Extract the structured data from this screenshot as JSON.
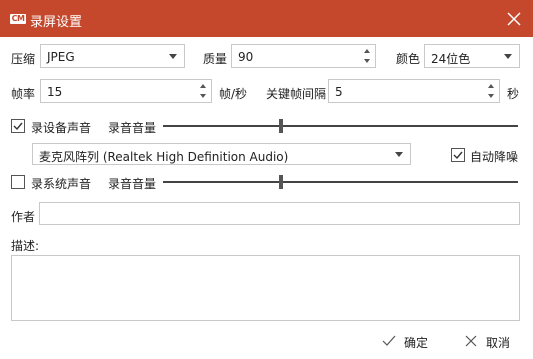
{
  "window": {
    "title": "录屏设置",
    "logo": "CM"
  },
  "compression": {
    "label": "压缩",
    "value": "JPEG"
  },
  "quality": {
    "label": "质量",
    "value": "90"
  },
  "color": {
    "label": "颜色",
    "value": "24位色"
  },
  "framerate": {
    "label": "帧率",
    "value": "15",
    "unit": "帧/秒"
  },
  "keyframe": {
    "label": "关键帧间隔",
    "value": "5",
    "unit": "秒"
  },
  "device_audio": {
    "checkbox_label": "录设备声音",
    "checked": true,
    "volume_label": "录音音量",
    "volume_level": 0.5,
    "device": "麦克风阵列 (Realtek High Definition Audio)",
    "noise_reduction_label": "自动降噪",
    "noise_reduction_checked": true
  },
  "system_audio": {
    "checkbox_label": "录系统声音",
    "checked": false,
    "volume_label": "录音音量",
    "volume_level": 0.5
  },
  "author": {
    "label": "作者",
    "value": ""
  },
  "description": {
    "label": "描述:",
    "value": ""
  },
  "buttons": {
    "ok": "确定",
    "cancel": "取消"
  }
}
